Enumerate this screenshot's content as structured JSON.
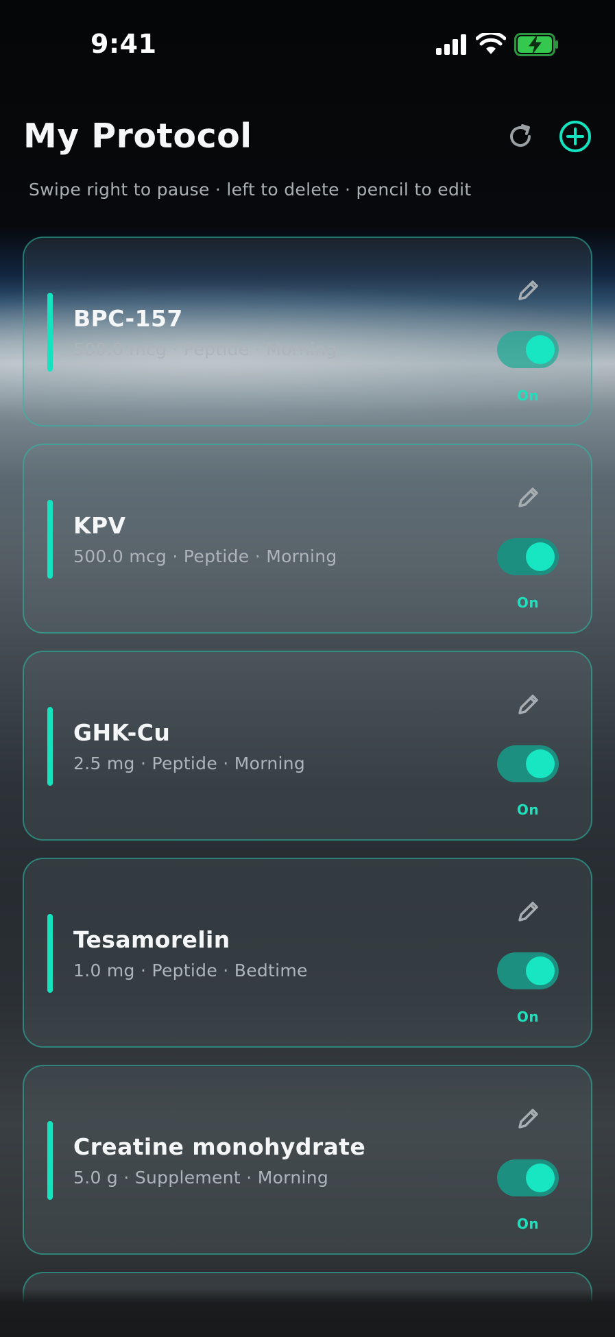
{
  "status_bar": {
    "time": "9:41",
    "icons": [
      "cellular-signal-icon",
      "wifi-icon",
      "battery-charging-icon"
    ]
  },
  "header": {
    "title": "My Protocol",
    "subtitle": "Swipe right to pause · left to delete · pencil to edit",
    "actions": [
      "refresh-icon",
      "add-circle-icon"
    ]
  },
  "colors": {
    "accent": "#14e3c0",
    "toggle_track": "#1d8f80",
    "card_border": "#28bea5"
  },
  "items": [
    {
      "name": "BPC-157",
      "detail": "500.0 mcg · Peptide · Morning",
      "state": "On",
      "enabled": true
    },
    {
      "name": "KPV",
      "detail": "500.0 mcg · Peptide · Morning",
      "state": "On",
      "enabled": true
    },
    {
      "name": "GHK-Cu",
      "detail": "2.5 mg · Peptide · Morning",
      "state": "On",
      "enabled": true
    },
    {
      "name": "Tesamorelin",
      "detail": "1.0 mg · Peptide · Bedtime",
      "state": "On",
      "enabled": true
    },
    {
      "name": "Creatine monohydrate",
      "detail": "5.0 g · Supplement · Morning",
      "state": "On",
      "enabled": true
    }
  ]
}
